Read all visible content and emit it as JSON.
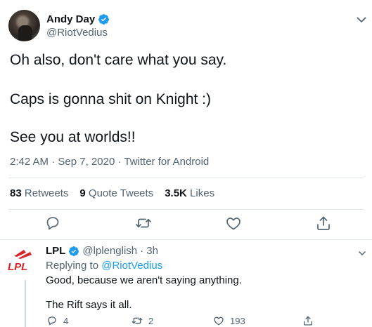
{
  "tweet": {
    "display_name": "Andy Day",
    "handle": "@RiotVedius",
    "lines": [
      "Oh also, don't care what you say.",
      "Caps is gonna shit on Knight :)",
      "See you at worlds!!"
    ],
    "time": "2:42 AM",
    "date": "Sep 7, 2020",
    "client": "Twitter for Android",
    "separator": "·",
    "stats": [
      {
        "count": "83",
        "label": "Retweets"
      },
      {
        "count": "9",
        "label": "Quote Tweets"
      },
      {
        "count": "3.5K",
        "label": "Likes"
      }
    ],
    "icons": [
      "reply-icon",
      "retweet-icon",
      "like-icon",
      "share-icon",
      "verified-badge-icon",
      "more-icon"
    ]
  },
  "reply": {
    "display_name": "LPL",
    "handle": "@lplenglish",
    "age": "· 3h",
    "replying_prefix": "Replying to",
    "replying_to": "@RiotVedius",
    "logo_text": "LPL",
    "lines": [
      "Good, because we aren't saying anything.",
      "The Rift says it all."
    ],
    "reply_count": "4",
    "retweet_count": "2",
    "like_count": "193"
  },
  "colors": {
    "accent": "#1d9bf0",
    "text_primary": "#0f1419",
    "text_secondary": "#536471",
    "lpl_red": "#d8232a",
    "divider": "#e1e8ed"
  }
}
